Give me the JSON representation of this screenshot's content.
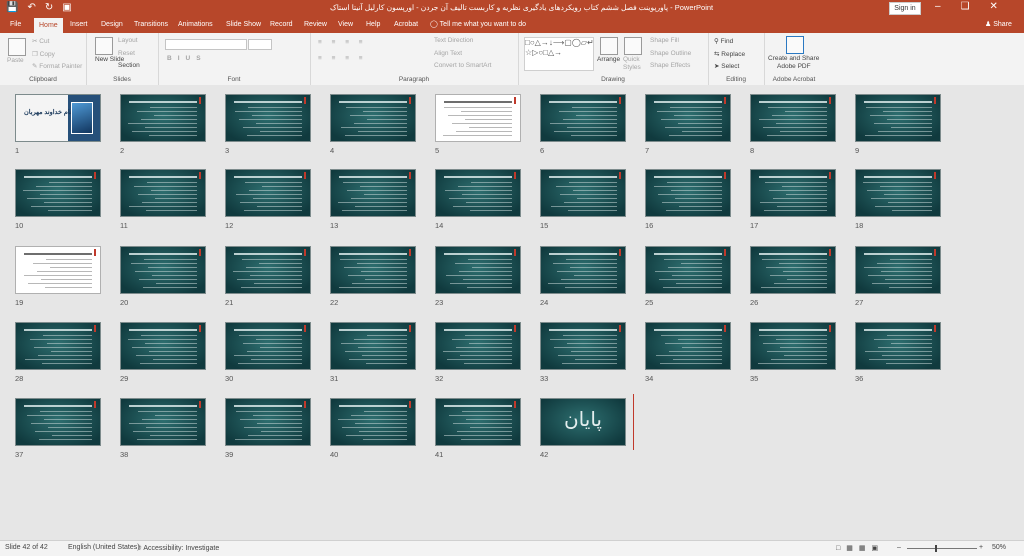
{
  "title": "پاورپوینت فصل ششم کتاب رویکردهای یادگیری نظریه و کاربست تالیف آن جردن - اورپسون کارلیل آنیتا استاک  -  PowerPoint",
  "signin": "Sign in",
  "share": "Share",
  "tabs": [
    "File",
    "Home",
    "Insert",
    "Design",
    "Transitions",
    "Animations",
    "Slide Show",
    "Record",
    "Review",
    "View",
    "Help",
    "Acrobat"
  ],
  "tell_me": "Tell me what you want to do",
  "ribbon": {
    "clipboard": {
      "label": "Clipboard",
      "paste": "Paste",
      "cut": "Cut",
      "copy": "Copy",
      "format_painter": "Format Painter"
    },
    "slides": {
      "label": "Slides",
      "new_slide": "New Slide",
      "layout": "Layout",
      "reset": "Reset",
      "section": "Section"
    },
    "font": {
      "label": "Font"
    },
    "paragraph": {
      "label": "Paragraph",
      "text_direction": "Text Direction",
      "align_text": "Align Text",
      "convert_smartart": "Convert to SmartArt"
    },
    "drawing": {
      "label": "Drawing",
      "arrange": "Arrange",
      "quick_styles": "Quick Styles",
      "shape_fill": "Shape Fill",
      "shape_outline": "Shape Outline",
      "shape_effects": "Shape Effects"
    },
    "editing": {
      "label": "Editing",
      "find": "Find",
      "replace": "Replace",
      "select": "Select"
    },
    "acrobat": {
      "label": "Adobe Acrobat",
      "create_share": "Create and Share",
      "adobe_pdf": "Adobe PDF"
    }
  },
  "slides": [
    {
      "n": "1",
      "style": "title",
      "title": "بنام خداوند مهربان"
    },
    {
      "n": "2",
      "style": "teal"
    },
    {
      "n": "3",
      "style": "teal"
    },
    {
      "n": "4",
      "style": "teal"
    },
    {
      "n": "5",
      "style": "white"
    },
    {
      "n": "6",
      "style": "teal"
    },
    {
      "n": "7",
      "style": "teal"
    },
    {
      "n": "8",
      "style": "teal"
    },
    {
      "n": "9",
      "style": "teal"
    },
    {
      "n": "10",
      "style": "teal"
    },
    {
      "n": "11",
      "style": "teal"
    },
    {
      "n": "12",
      "style": "teal"
    },
    {
      "n": "13",
      "style": "teal"
    },
    {
      "n": "14",
      "style": "teal"
    },
    {
      "n": "15",
      "style": "teal"
    },
    {
      "n": "16",
      "style": "teal"
    },
    {
      "n": "17",
      "style": "teal"
    },
    {
      "n": "18",
      "style": "teal"
    },
    {
      "n": "19",
      "style": "white"
    },
    {
      "n": "20",
      "style": "teal"
    },
    {
      "n": "21",
      "style": "teal"
    },
    {
      "n": "22",
      "style": "teal"
    },
    {
      "n": "23",
      "style": "teal"
    },
    {
      "n": "24",
      "style": "teal"
    },
    {
      "n": "25",
      "style": "teal"
    },
    {
      "n": "26",
      "style": "teal"
    },
    {
      "n": "27",
      "style": "teal"
    },
    {
      "n": "28",
      "style": "teal"
    },
    {
      "n": "29",
      "style": "teal"
    },
    {
      "n": "30",
      "style": "teal"
    },
    {
      "n": "31",
      "style": "teal"
    },
    {
      "n": "32",
      "style": "teal"
    },
    {
      "n": "33",
      "style": "teal"
    },
    {
      "n": "34",
      "style": "teal"
    },
    {
      "n": "35",
      "style": "teal"
    },
    {
      "n": "36",
      "style": "teal"
    },
    {
      "n": "37",
      "style": "teal"
    },
    {
      "n": "38",
      "style": "teal"
    },
    {
      "n": "39",
      "style": "teal"
    },
    {
      "n": "40",
      "style": "teal"
    },
    {
      "n": "41",
      "style": "teal"
    },
    {
      "n": "42",
      "style": "end",
      "title": "پایان"
    }
  ],
  "status": {
    "slide_info": "Slide 42 of 42",
    "language": "English (United States)",
    "accessibility": "Accessibility: Investigate",
    "zoom": "50%"
  },
  "colors": {
    "accent": "#b7472a",
    "slide_teal": "#1f5a5c"
  }
}
